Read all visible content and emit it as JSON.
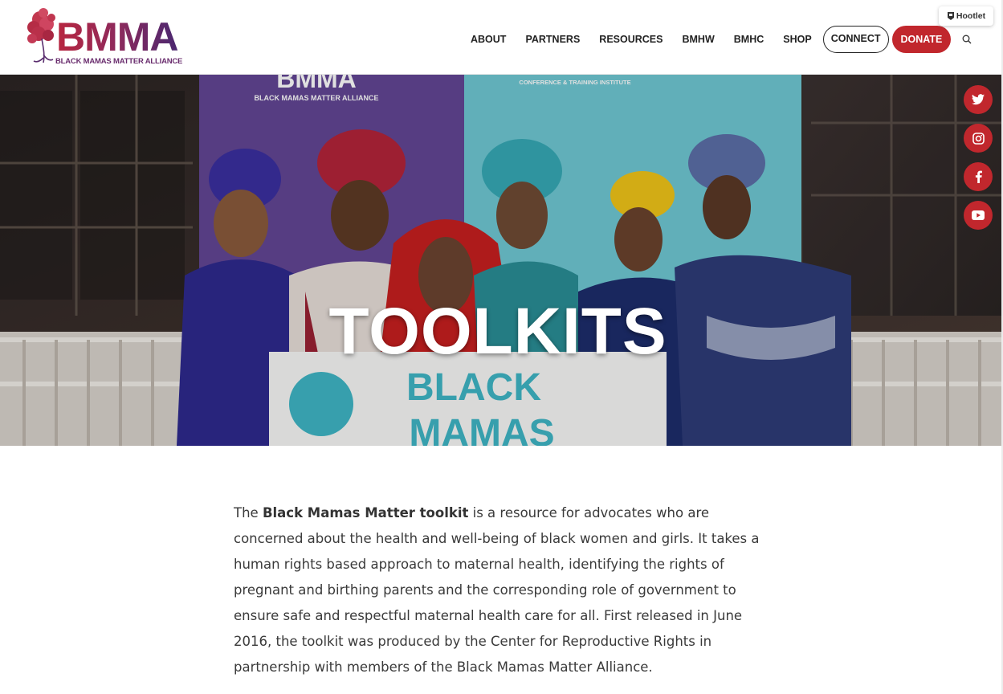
{
  "logo": {
    "word": "BMMA",
    "tagline": "BLACK MAMAS MATTER ALLIANCE"
  },
  "nav": {
    "items": [
      "ABOUT",
      "PARTNERS",
      "RESOURCES",
      "BMHW",
      "BMHC",
      "SHOP"
    ],
    "connect": "CONNECT",
    "donate": "DONATE",
    "search_icon": "search-icon"
  },
  "hootlet": {
    "label": "Hootlet"
  },
  "hero": {
    "title": "TOOLKITS",
    "banner_top": "BMMA",
    "banner_sub": "BLACK MAMAS MATTER ALLIANCE",
    "banner_right": "CONFERENCE & TRAINING INSTITUTE",
    "sign_line1": "BLACK",
    "sign_line2": "MAMAS"
  },
  "social": [
    {
      "name": "twitter-icon"
    },
    {
      "name": "instagram-icon"
    },
    {
      "name": "facebook-icon"
    },
    {
      "name": "youtube-icon"
    }
  ],
  "content": {
    "intro": "The ",
    "bold": "Black Mamas Matter toolkit",
    "body": " is a resource for advocates who are concerned about the health and well-being of black women and girls. It takes a human rights based approach to maternal health, identifying the rights of pregnant and birthing parents and the corresponding role of government to ensure safe and respectful maternal health care for all. First released in June 2016, the toolkit was produced by the Center for Reproductive Rights in partnership with members of the Black Mamas Matter Alliance."
  },
  "colors": {
    "accent": "#c1272d",
    "brand_purple": "#4a2770",
    "text": "#3a3a3a"
  }
}
